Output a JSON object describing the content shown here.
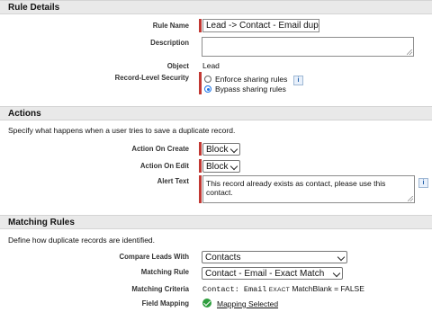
{
  "rule_details": {
    "header": "Rule Details",
    "rule_name_label": "Rule Name",
    "rule_name_value": "Lead -> Contact - Email dupl",
    "description_label": "Description",
    "object_label": "Object",
    "object_value": "Lead",
    "security_label": "Record-Level Security",
    "security_options": [
      "Enforce sharing rules",
      "Bypass sharing rules"
    ],
    "security_selected": "Bypass sharing rules"
  },
  "actions": {
    "header": "Actions",
    "description": "Specify what happens when a user tries to save a duplicate record.",
    "on_create_label": "Action On Create",
    "on_create_value": "Block",
    "on_edit_label": "Action On Edit",
    "on_edit_value": "Block",
    "alert_label": "Alert Text",
    "alert_value": "This record already exists as contact, please use this contact."
  },
  "matching_rules": {
    "header": "Matching Rules",
    "description": "Define how duplicate records are identified.",
    "compare_label": "Compare Leads With",
    "compare_value": "Contacts",
    "rule_label": "Matching Rule",
    "rule_value": "Contact - Email - Exact Match",
    "criteria_label": "Matching Criteria",
    "criteria_field": "Contact: Email",
    "criteria_type": "EXACT",
    "criteria_rest": "MatchBlank = FALSE",
    "mapping_label": "Field Mapping",
    "mapping_link": "Mapping Selected"
  },
  "icons": {
    "info": "i",
    "check_color": "#2e9e3e",
    "required_color": "#c23934"
  }
}
